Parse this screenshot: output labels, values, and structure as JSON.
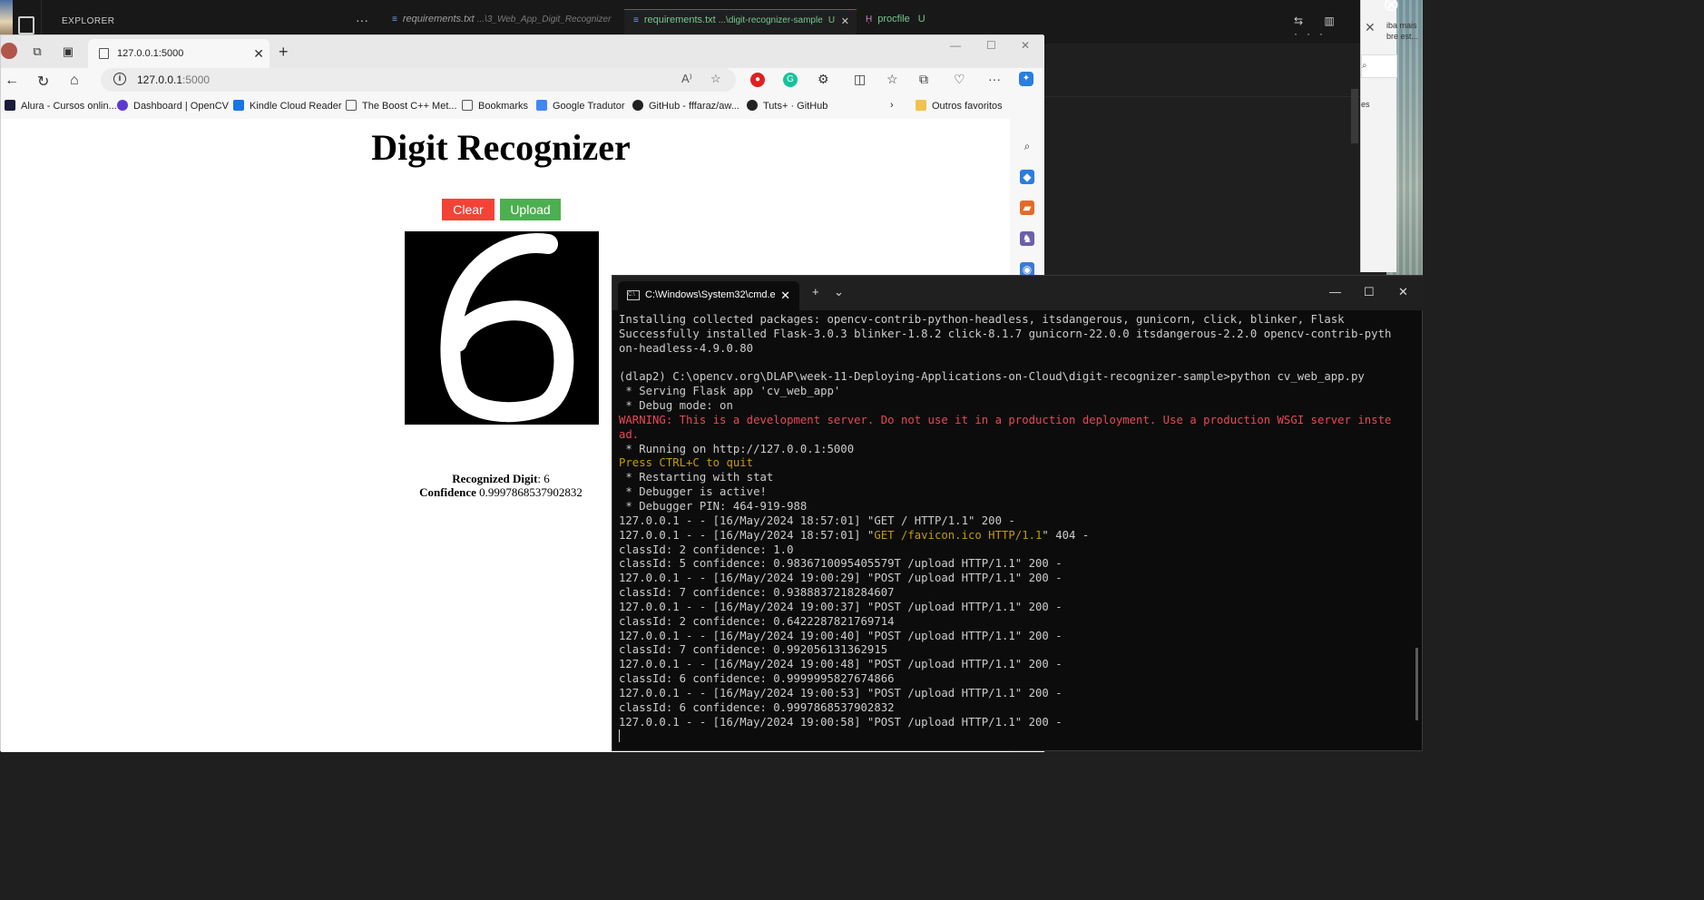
{
  "vscode": {
    "explorer_label": "EXPLORER",
    "tabs": [
      {
        "name": "requirements.txt",
        "path": "...\\3_Web_App_Digit_Recognizer",
        "status": ""
      },
      {
        "name": "requirements.txt",
        "path": "...\\digit-recognizer-sample",
        "status": "U"
      },
      {
        "name": "procfile",
        "path": "",
        "status": "U"
      }
    ]
  },
  "browser": {
    "tab_title": "127.0.0.1:5000",
    "address_host": "127.0.0.1",
    "address_port": ":5000",
    "bookmarks": [
      "Alura - Cursos onlin...",
      "Dashboard | OpenCV",
      "Kindle Cloud Reader",
      "The Boost C++ Met...",
      "Bookmarks",
      "Google Tradutor",
      "GitHub - fffaraz/aw...",
      "Tuts+ · GitHub",
      "Outros favoritos"
    ]
  },
  "page": {
    "title": "Digit Recognizer",
    "clear_label": "Clear",
    "upload_label": "Upload",
    "digit_label": "Recognized Digit",
    "digit_value": ": 6",
    "confidence_label": "Confidence",
    "confidence_value": " 0.9997868537902832"
  },
  "notification": {
    "text": "iba mais bre est...",
    "es": "es"
  },
  "terminal": {
    "tab_title": "C:\\Windows\\System32\\cmd.e",
    "lines": [
      {
        "text": "Installing collected packages: opencv-contrib-python-headless, itsdangerous, gunicorn, click, blinker, Flask",
        "color": "default"
      },
      {
        "text": "Successfully installed Flask-3.0.3 blinker-1.8.2 click-8.1.7 gunicorn-22.0.0 itsdangerous-2.2.0 opencv-contrib-pyth",
        "color": "default"
      },
      {
        "text": "on-headless-4.9.0.80",
        "color": "default"
      },
      {
        "text": "",
        "color": "default"
      },
      {
        "text": "(dlap2) C:\\opencv.org\\DLAP\\week-11-Deploying-Applications-on-Cloud\\digit-recognizer-sample>python cv_web_app.py",
        "color": "default"
      },
      {
        "text": " * Serving Flask app 'cv_web_app'",
        "color": "default"
      },
      {
        "text": " * Debug mode: on",
        "color": "default"
      },
      {
        "text": "WARNING: This is a development server. Do not use it in a production deployment. Use a production WSGI server inste",
        "color": "red"
      },
      {
        "text": "ad.",
        "color": "red"
      },
      {
        "text": " * Running on http://127.0.0.1:5000",
        "color": "default"
      },
      {
        "text": "Press CTRL+C to quit",
        "color": "yellow"
      },
      {
        "text": " * Restarting with stat",
        "color": "default"
      },
      {
        "text": " * Debugger is active!",
        "color": "default"
      },
      {
        "text": " * Debugger PIN: 464-919-988",
        "color": "default"
      },
      {
        "text": "127.0.0.1 - - [16/May/2024 18:57:01] \"GET / HTTP/1.1\" 200 -",
        "color": "default"
      },
      {
        "text": "127.0.0.1 - - [16/May/2024 18:57:01] \"",
        "mid": "GET /favicon.ico HTTP/1.1",
        "end": "\" 404 -",
        "color": "mixed"
      },
      {
        "text": "classId: 2 confidence: 1.0",
        "color": "default"
      },
      {
        "text": "classId: 5 confidence: 0.9836710095405579T /upload HTTP/1.1\" 200 -",
        "color": "default"
      },
      {
        "text": "127.0.0.1 - - [16/May/2024 19:00:29] \"POST /upload HTTP/1.1\" 200 -",
        "color": "default"
      },
      {
        "text": "classId: 7 confidence: 0.9388837218284607",
        "color": "default"
      },
      {
        "text": "127.0.0.1 - - [16/May/2024 19:00:37] \"POST /upload HTTP/1.1\" 200 -",
        "color": "default"
      },
      {
        "text": "classId: 2 confidence: 0.6422287821769714",
        "color": "default"
      },
      {
        "text": "127.0.0.1 - - [16/May/2024 19:00:40] \"POST /upload HTTP/1.1\" 200 -",
        "color": "default"
      },
      {
        "text": "classId: 7 confidence: 0.992056131362915",
        "color": "default"
      },
      {
        "text": "127.0.0.1 - - [16/May/2024 19:00:48] \"POST /upload HTTP/1.1\" 200 -",
        "color": "default"
      },
      {
        "text": "classId: 6 confidence: 0.9999995827674866",
        "color": "default"
      },
      {
        "text": "127.0.0.1 - - [16/May/2024 19:00:53] \"POST /upload HTTP/1.1\" 200 -",
        "color": "default"
      },
      {
        "text": "classId: 6 confidence: 0.9997868537902832",
        "color": "default"
      },
      {
        "text": "127.0.0.1 - - [16/May/2024 19:00:58] \"POST /upload HTTP/1.1\" 200 -",
        "color": "default"
      }
    ]
  },
  "colors": {
    "clear_button": "#f44336",
    "upload_button": "#4caf50",
    "terminal_warning": "#e74856",
    "terminal_highlight": "#c19c00"
  }
}
